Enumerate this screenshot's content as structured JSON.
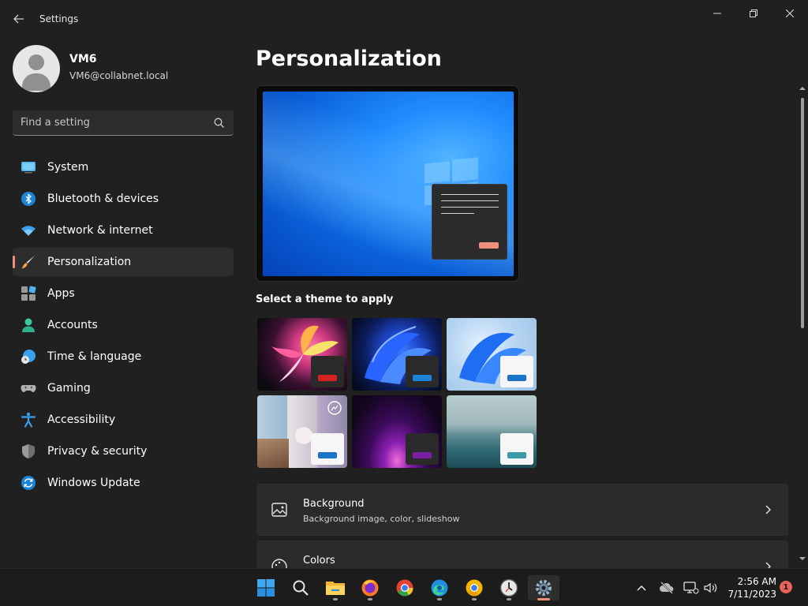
{
  "window": {
    "title": "Settings",
    "back_icon": "arrow-left-icon",
    "controls": [
      "minimize-icon",
      "maximize-icon",
      "close-icon"
    ]
  },
  "profile": {
    "name": "VM6",
    "email": "VM6@collabnet.local"
  },
  "search": {
    "placeholder": "Find a setting",
    "value": ""
  },
  "sidebar": {
    "items": [
      {
        "label": "System",
        "icon": "system-icon",
        "active": false
      },
      {
        "label": "Bluetooth & devices",
        "icon": "bluetooth-icon",
        "active": false
      },
      {
        "label": "Network & internet",
        "icon": "wifi-icon",
        "active": false
      },
      {
        "label": "Personalization",
        "icon": "brush-icon",
        "active": true
      },
      {
        "label": "Apps",
        "icon": "apps-icon",
        "active": false
      },
      {
        "label": "Accounts",
        "icon": "accounts-icon",
        "active": false
      },
      {
        "label": "Time & language",
        "icon": "globe-clock-icon",
        "active": false
      },
      {
        "label": "Gaming",
        "icon": "gamepad-icon",
        "active": false
      },
      {
        "label": "Accessibility",
        "icon": "accessibility-icon",
        "active": false
      },
      {
        "label": "Privacy & security",
        "icon": "shield-icon",
        "active": false
      },
      {
        "label": "Windows Update",
        "icon": "update-icon",
        "active": false
      }
    ]
  },
  "main": {
    "title": "Personalization",
    "themes_label": "Select a theme to apply",
    "cards": [
      {
        "title": "Background",
        "subtitle": "Background image, color, slideshow",
        "icon": "image-icon"
      },
      {
        "title": "Colors",
        "subtitle": "",
        "icon": "palette-icon"
      }
    ]
  },
  "colors": {
    "accent": "#f08f7e",
    "background": "#202020",
    "card": "#2b2b2b"
  },
  "taskbar": {
    "apps": [
      "windows-start-icon",
      "search-icon",
      "file-explorer-icon",
      "firefox-icon",
      "chrome-icon",
      "edge-icon",
      "chrome-canary-icon",
      "clock-app-icon",
      "settings-icon"
    ],
    "time": "2:56 AM",
    "date": "7/11/2023",
    "notification_count": "1"
  }
}
